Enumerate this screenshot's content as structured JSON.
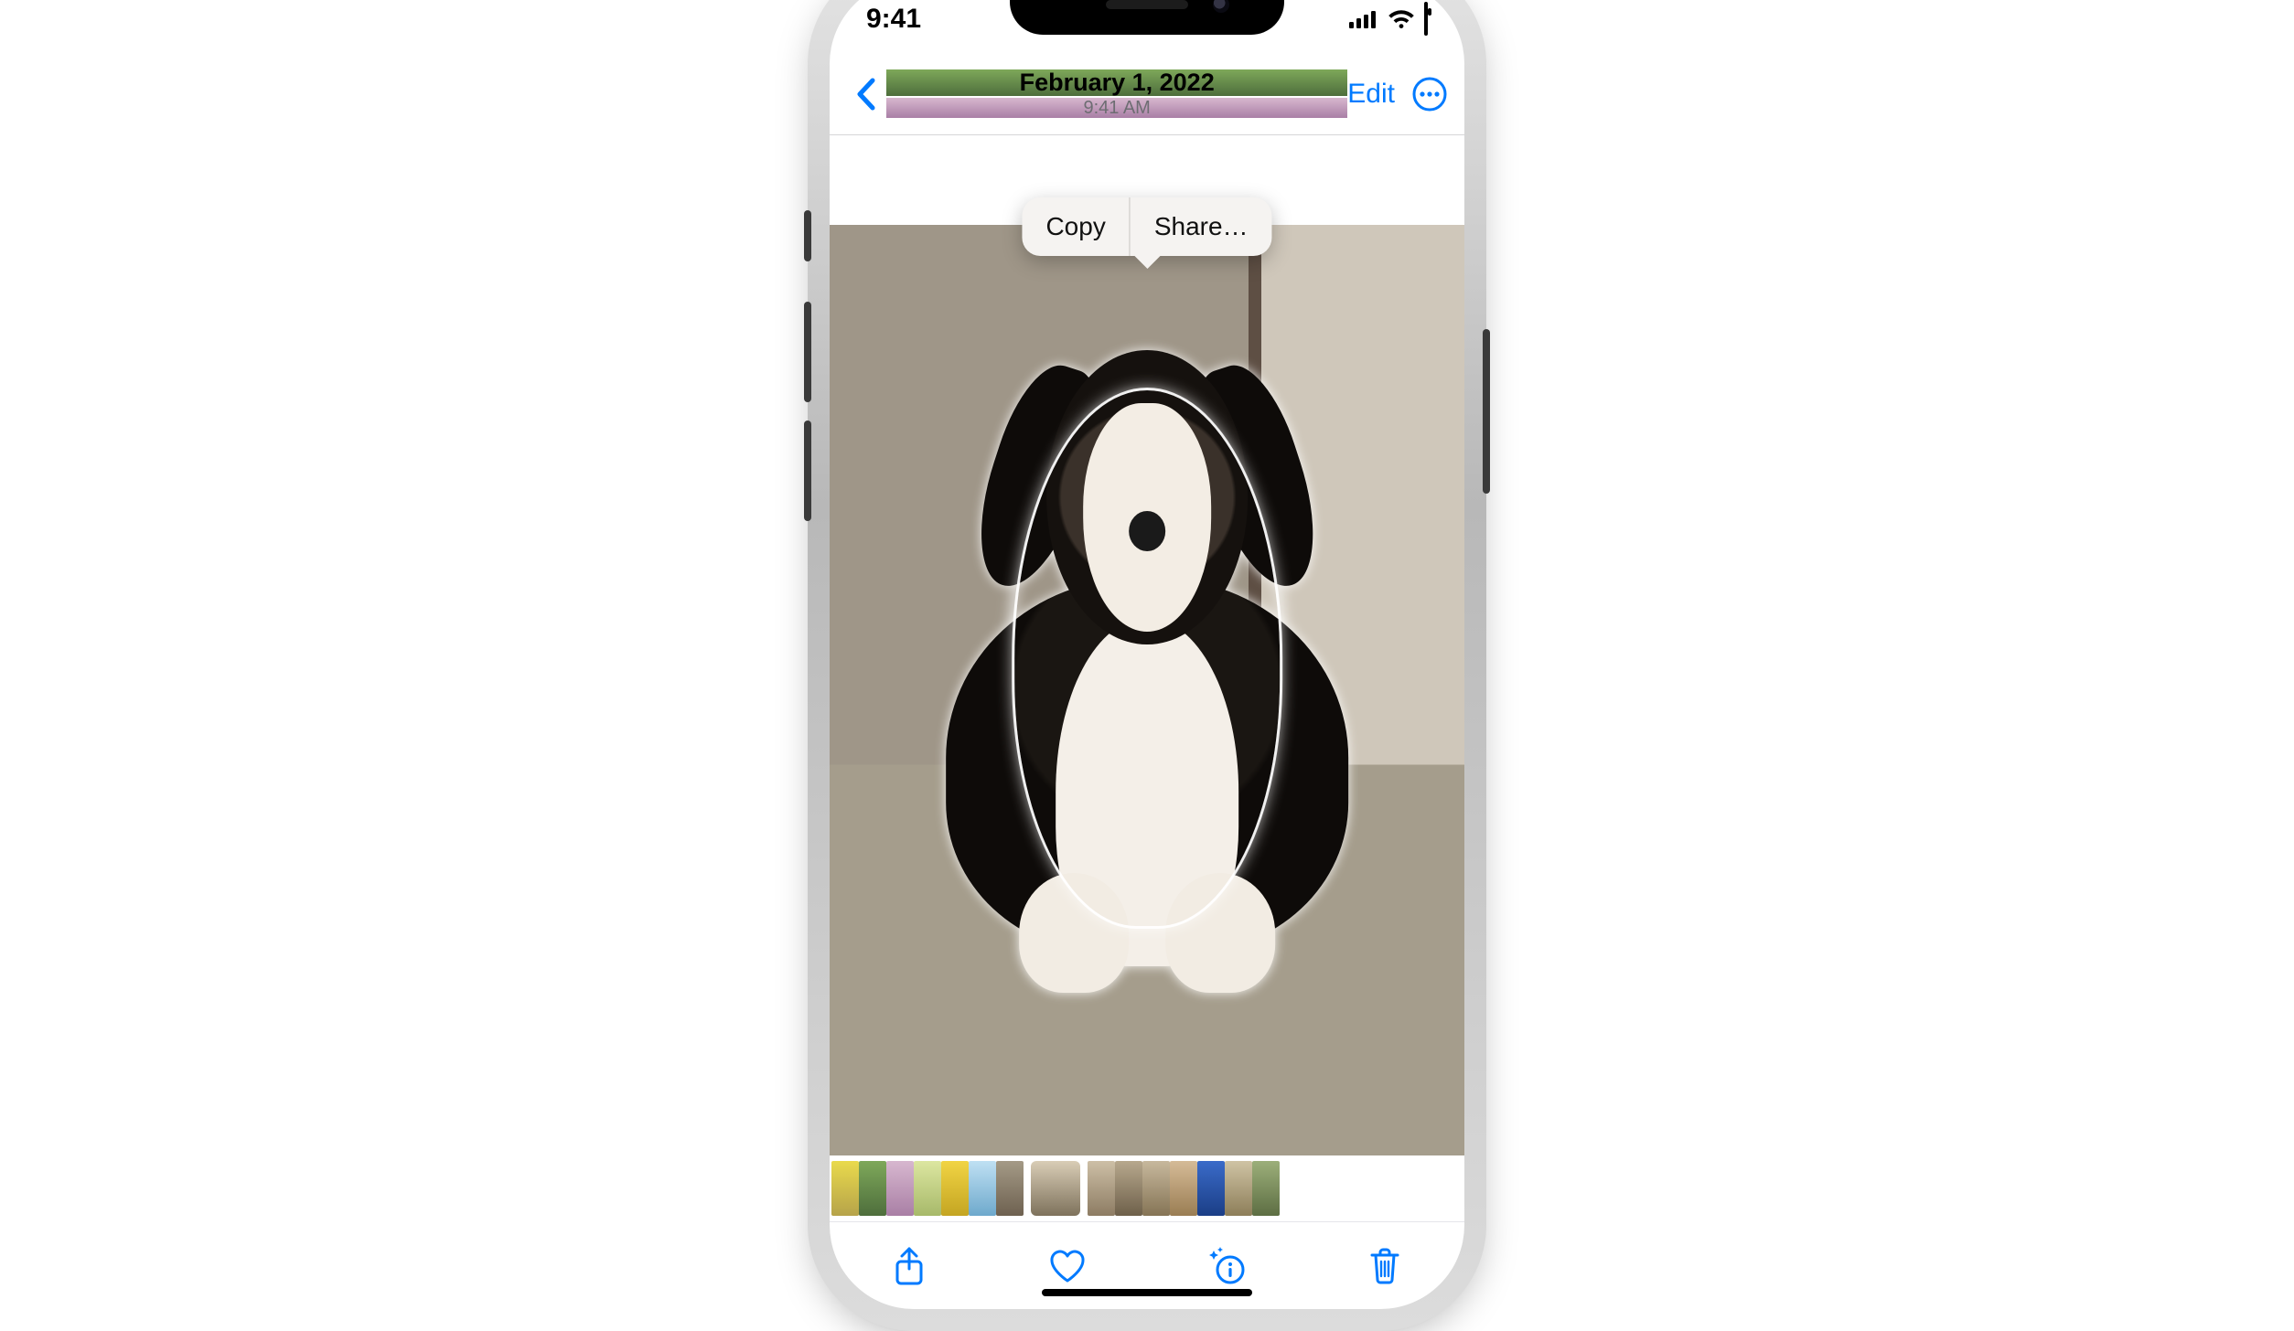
{
  "status": {
    "time": "9:41"
  },
  "nav": {
    "title": "February 1, 2022",
    "subtitle": "9:41 AM",
    "edit": "Edit"
  },
  "callout": {
    "copy": "Copy",
    "share": "Share…"
  },
  "photo": {
    "subject": "puppy-dog",
    "lifted": true
  },
  "thumbs": {
    "count": 15,
    "selected_index": 7,
    "tints": [
      "t0",
      "t1",
      "t2",
      "t3",
      "t4",
      "t5",
      "t6",
      "t7",
      "t8",
      "t9",
      "t10",
      "t11",
      "t12",
      "t13",
      "t14"
    ]
  },
  "icons": {
    "back": "chevron-left-icon",
    "more": "ellipsis-circle-icon",
    "share": "share-icon",
    "favorite": "heart-icon",
    "info": "info-sparkle-icon",
    "trash": "trash-icon",
    "cell": "cellular-icon",
    "wifi": "wifi-icon",
    "battery": "battery-icon"
  },
  "colors": {
    "accent": "#007aff"
  }
}
